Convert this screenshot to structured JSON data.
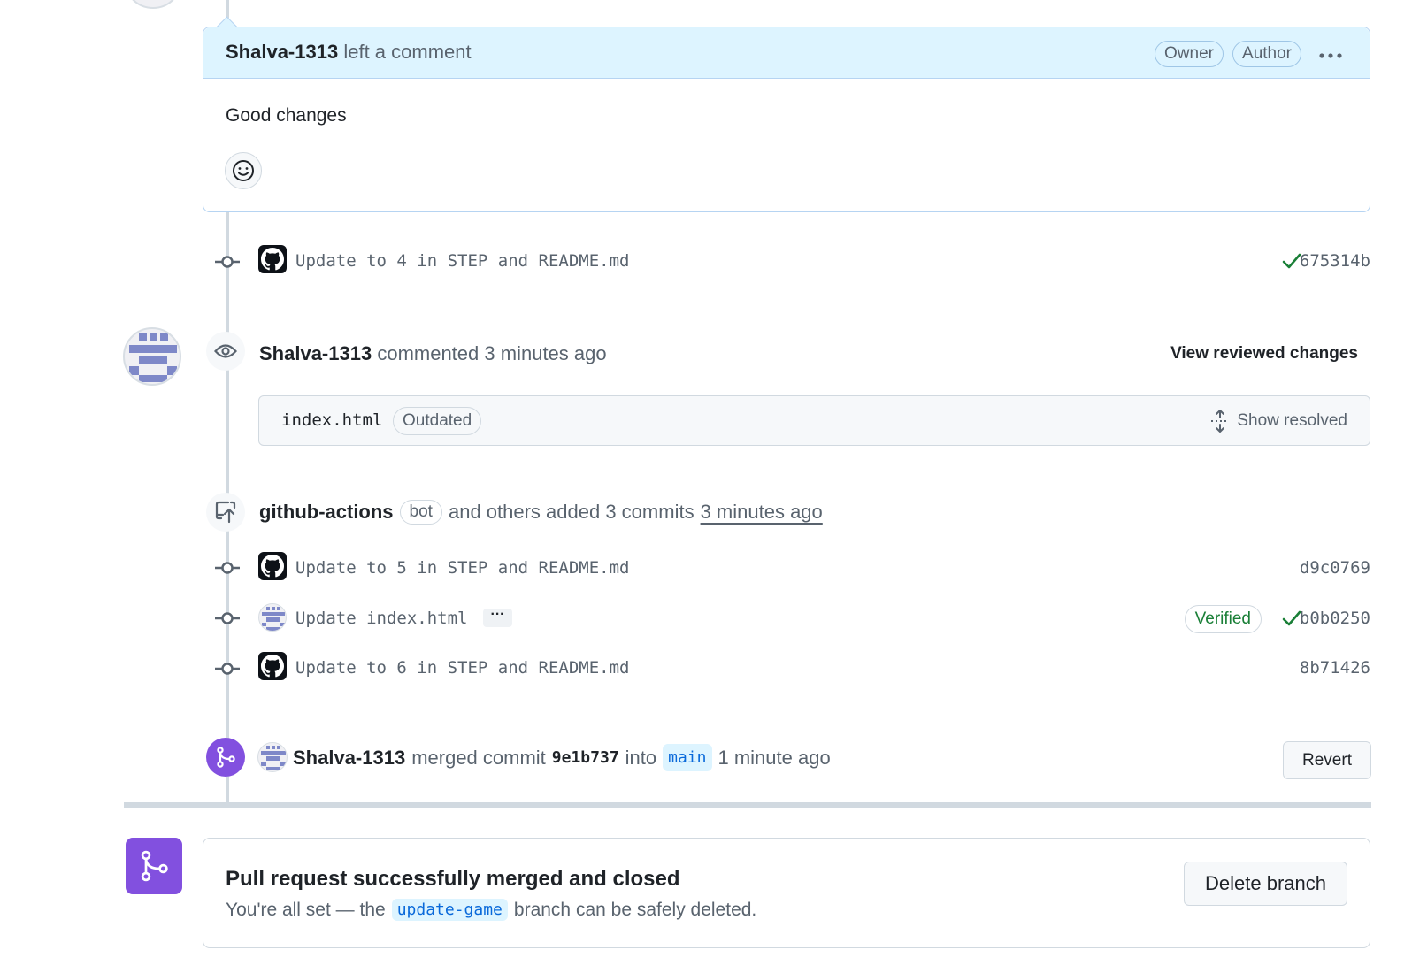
{
  "comment": {
    "author": "Shalva-1313",
    "action": "left a comment",
    "badges": [
      "Owner",
      "Author"
    ],
    "more_icon": "kebab-horizontal-icon",
    "body": "Good changes",
    "reaction_icon": "smiley-icon"
  },
  "commit_1": {
    "message": "Update to 4 in STEP and README.md",
    "sha": "675314b",
    "status": "success"
  },
  "review": {
    "author": "Shalva-1313",
    "action": "commented",
    "time": "3 minutes ago",
    "view_changes": "View reviewed changes",
    "file_name": "index.html",
    "file_badge": "Outdated",
    "show_resolved": "Show resolved"
  },
  "push_event": {
    "actor": "github-actions",
    "bot_badge": "bot",
    "action": "and others added 3 commits",
    "time": "3 minutes ago"
  },
  "commits": [
    {
      "message": "Update to 5 in STEP and README.md",
      "sha": "d9c0769"
    },
    {
      "message": "Update index.html",
      "sha": "b0b0250",
      "verified": "Verified",
      "more": "···"
    },
    {
      "message": "Update to 6 in STEP and README.md",
      "sha": "8b71426"
    }
  ],
  "merge_event": {
    "author": "Shalva-1313",
    "action": "merged commit",
    "commit": "9e1b737",
    "into": "into",
    "branch": "main",
    "time": "1 minute ago",
    "revert_label": "Revert"
  },
  "merged_box": {
    "title": "Pull request successfully merged and closed",
    "desc_prefix": "You're all set — the",
    "branch": "update-game",
    "desc_suffix": "branch can be safely deleted.",
    "delete_label": "Delete branch"
  },
  "colors": {
    "merged_purple": "#8250df",
    "success_green": "#1a7f37",
    "comment_header_bg": "#ddf4ff",
    "identicon": "#7e88c8"
  }
}
